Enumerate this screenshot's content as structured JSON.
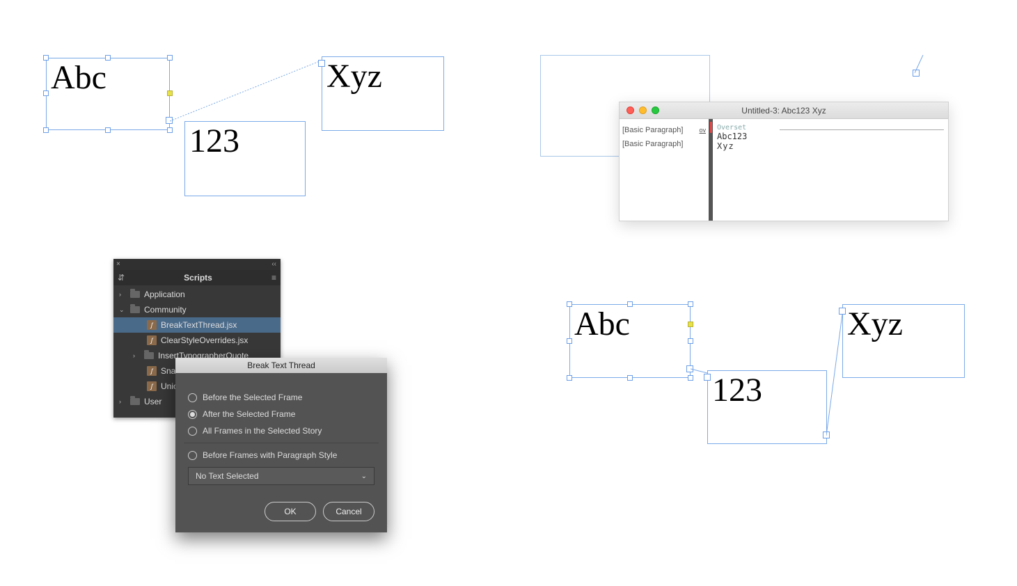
{
  "topLeft": {
    "frame1_text": "Abc",
    "frame2_text": "123",
    "frame3_text": "Xyz"
  },
  "storyEditor": {
    "title": "Untitled-3: Abc123 Xyz",
    "rows": [
      {
        "style": "[Basic Paragraph]",
        "badge": "ov",
        "line": "Abc123",
        "overset": true
      },
      {
        "style": "[Basic Paragraph]",
        "badge": "",
        "line": "Xyz",
        "overset": false
      }
    ],
    "overset_label": "Overset"
  },
  "scriptsPanel": {
    "tab": "Scripts",
    "tree": {
      "application": "Application",
      "community": "Community",
      "scripts": [
        "BreakTextThread.jsx",
        "ClearStyleOverrides.jsx",
        "InsertTypographerQuote",
        "Snap",
        "Unicc"
      ],
      "user": "User"
    }
  },
  "dialog": {
    "title": "Break Text Thread",
    "options": [
      "Before the Selected Frame",
      "After the Selected Frame",
      "All Frames in the Selected Story",
      "Before Frames with Paragraph Style"
    ],
    "selected_index": 1,
    "select_value": "No Text Selected",
    "ok": "OK",
    "cancel": "Cancel"
  },
  "bottomRight": {
    "frame1_text": "Abc",
    "frame2_text": "123",
    "frame3_text": "Xyz"
  }
}
